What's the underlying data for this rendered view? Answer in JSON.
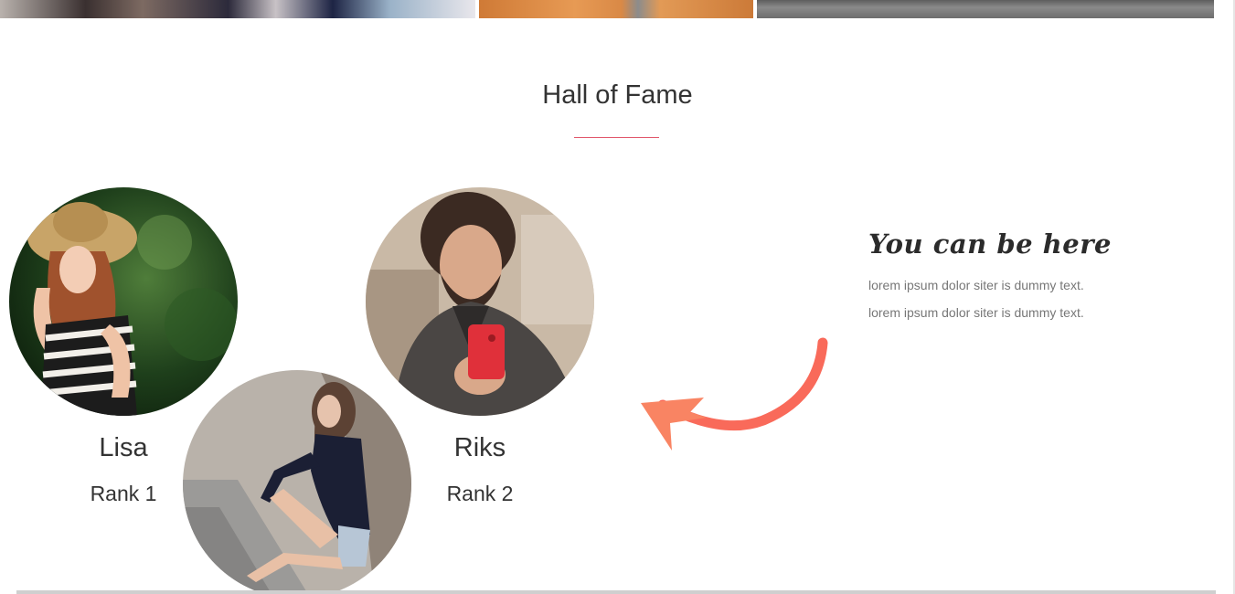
{
  "section": {
    "title": "Hall of Fame",
    "accent_color": "#e1576c"
  },
  "members": [
    {
      "name": "Lisa",
      "rank": "Rank 1",
      "photo": "woman-in-hat-photo"
    },
    {
      "name": "Riks",
      "rank": "Rank 2",
      "photo": "man-with-phone-photo"
    },
    {
      "photo": "woman-sitting-photo"
    }
  ],
  "cta": {
    "heading": "You can be here",
    "lines": [
      "lorem ipsum dolor siter is dummy text.",
      "lorem ipsum dolor siter is dummy text."
    ],
    "arrow_icon": "curved-arrow-icon",
    "arrow_color": "#f96a5a"
  }
}
